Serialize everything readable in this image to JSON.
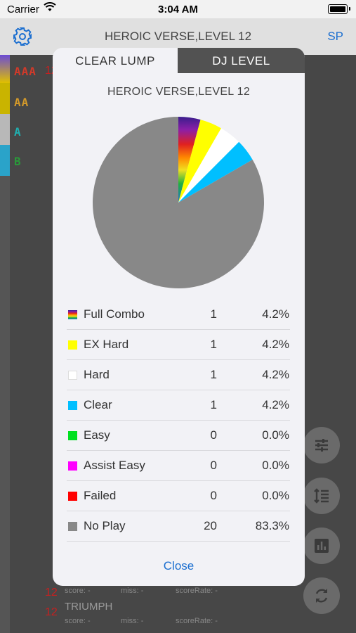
{
  "status_bar": {
    "carrier": "Carrier",
    "time": "3:04 AM"
  },
  "nav": {
    "title": "HEROIC VERSE,LEVEL 12",
    "right_button": "SP",
    "left_icon": "gear-icon"
  },
  "background_list": {
    "grades": [
      "AAA",
      "AA",
      "A",
      "B"
    ],
    "level": "12",
    "visible_song": "TRIUMPH",
    "score_label": "score: -",
    "miss_label": "miss: -",
    "rate_label": "scoreRate: -"
  },
  "modal": {
    "tabs": [
      {
        "label": "CLEAR LUMP",
        "active": true
      },
      {
        "label": "DJ LEVEL",
        "active": false
      }
    ],
    "chart_title": "HEROIC VERSE,LEVEL 12",
    "close_label": "Close"
  },
  "legend": [
    {
      "label": "Full Combo",
      "count": "1",
      "percent": "4.2%",
      "color": "rainbow"
    },
    {
      "label": "EX Hard",
      "count": "1",
      "percent": "4.2%",
      "color": "#ffff00"
    },
    {
      "label": "Hard",
      "count": "1",
      "percent": "4.2%",
      "color": "#ffffff"
    },
    {
      "label": "Clear",
      "count": "1",
      "percent": "4.2%",
      "color": "#00bfff"
    },
    {
      "label": "Easy",
      "count": "0",
      "percent": "0.0%",
      "color": "#00e020"
    },
    {
      "label": "Assist Easy",
      "count": "0",
      "percent": "0.0%",
      "color": "#ff00ff"
    },
    {
      "label": "Failed",
      "count": "0",
      "percent": "0.0%",
      "color": "#ff0000"
    },
    {
      "label": "No Play",
      "count": "20",
      "percent": "83.3%",
      "color": "#888888"
    }
  ],
  "chart_data": {
    "type": "pie",
    "title": "HEROIC VERSE,LEVEL 12",
    "categories": [
      "Full Combo",
      "EX Hard",
      "Hard",
      "Clear",
      "Easy",
      "Assist Easy",
      "Failed",
      "No Play"
    ],
    "values": [
      1,
      1,
      1,
      1,
      0,
      0,
      0,
      20
    ],
    "colors": [
      "rainbow",
      "#ffff00",
      "#ffffff",
      "#00bfff",
      "#00e020",
      "#ff00ff",
      "#ff0000",
      "#888888"
    ]
  },
  "fab_icons": [
    "sliders-icon",
    "sort-lines-icon",
    "bar-chart-icon",
    "refresh-icon"
  ]
}
